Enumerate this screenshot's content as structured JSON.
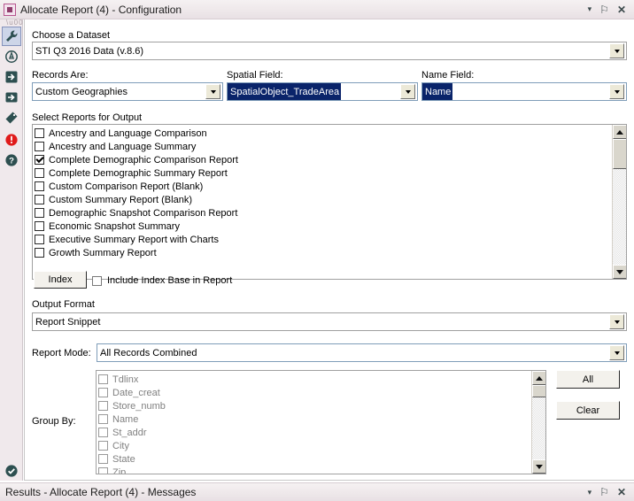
{
  "window": {
    "title": "Allocate Report (4) - Configuration",
    "icon": "report-window-icon",
    "controls": {
      "menu": "▾",
      "pin": "⚐",
      "close": "✕"
    }
  },
  "toolbar": {
    "items": [
      {
        "name": "wrench-icon",
        "selected": true
      },
      {
        "name": "target-circle-icon",
        "selected": false
      },
      {
        "name": "arrow-into-box-icon",
        "selected": false
      },
      {
        "name": "arrow-right-box-icon",
        "selected": false
      },
      {
        "name": "tag-icon",
        "selected": false
      },
      {
        "name": "error-icon",
        "selected": false
      },
      {
        "name": "help-icon",
        "selected": false
      },
      {
        "name": "check-circle-icon",
        "selected": false
      }
    ]
  },
  "form": {
    "dataset": {
      "label": "Choose a Dataset",
      "value": "STI Q3 2016 Data (v.8.6)"
    },
    "records_are": {
      "label": "Records Are:",
      "value": "Custom Geographies"
    },
    "spatial_field": {
      "label": "Spatial Field:",
      "value": "SpatialObject_TradeArea"
    },
    "name_field": {
      "label": "Name Field:",
      "value": "Name"
    },
    "reports": {
      "label": "Select Reports for Output",
      "items": [
        {
          "label": "Ancestry and Language Comparison",
          "checked": false
        },
        {
          "label": "Ancestry and Language Summary",
          "checked": false
        },
        {
          "label": "Complete Demographic Comparison Report",
          "checked": true
        },
        {
          "label": "Complete Demographic Summary Report",
          "checked": false
        },
        {
          "label": "Custom Comparison Report (Blank)",
          "checked": false
        },
        {
          "label": "Custom Summary Report (Blank)",
          "checked": false
        },
        {
          "label": "Demographic Snapshot Comparison Report",
          "checked": false
        },
        {
          "label": "Economic Snapshot Summary",
          "checked": false
        },
        {
          "label": "Executive Summary Report with Charts",
          "checked": false
        },
        {
          "label": "Growth Summary Report",
          "checked": false
        }
      ]
    },
    "index_button": "Index",
    "include_index_base": {
      "label": "Include Index Base in Report",
      "checked": false
    },
    "output_format": {
      "label": "Output Format",
      "value": "Report Snippet"
    },
    "report_mode": {
      "label": "Report Mode:",
      "value": "All Records Combined"
    },
    "group_by": {
      "label": "Group By:",
      "items": [
        {
          "label": "Tdlinx",
          "checked": false
        },
        {
          "label": "Date_creat",
          "checked": false
        },
        {
          "label": "Store_numb",
          "checked": false
        },
        {
          "label": "Name",
          "checked": false
        },
        {
          "label": "St_addr",
          "checked": false
        },
        {
          "label": "City",
          "checked": false
        },
        {
          "label": "State",
          "checked": false
        },
        {
          "label": "Zip",
          "checked": false
        }
      ],
      "all_button": "All",
      "clear_button": "Clear"
    }
  },
  "results": {
    "title": "Results - Allocate Report (4) - Messages",
    "controls": {
      "menu": "▾",
      "pin": "⚐",
      "close": "✕"
    }
  }
}
